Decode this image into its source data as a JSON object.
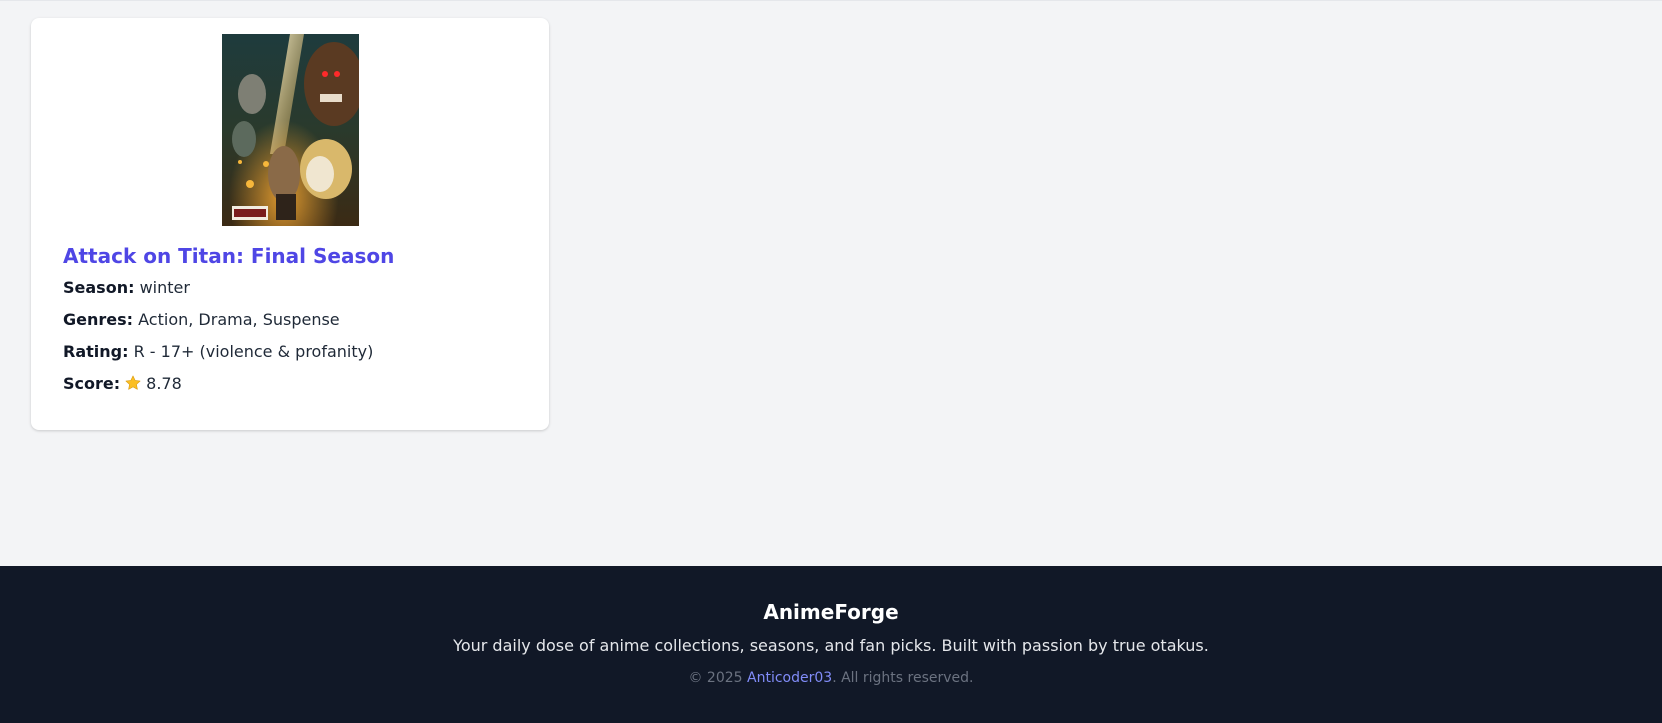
{
  "anime_card": {
    "poster_alt": "Attack on Titan: Final Season poster",
    "title": "Attack on Titan: Final Season",
    "season_label": "Season:",
    "season_value": "winter",
    "genres_label": "Genres:",
    "genres_value": "Action, Drama, Suspense",
    "rating_label": "Rating:",
    "rating_value": "R - 17+ (violence & profanity)",
    "score_label": "Score:",
    "score_icon": "star-icon",
    "score_value": "8.78"
  },
  "footer": {
    "brand": "AnimeForge",
    "tagline": "Your daily dose of anime collections, seasons, and fan picks. Built with passion by true otakus.",
    "copyright_prefix": "© 2025 ",
    "author_link": "Anticoder03",
    "copyright_suffix": ". All rights reserved."
  },
  "colors": {
    "page_background": "#f3f4f6",
    "title_accent": "#4f46e5",
    "footer_background": "#111827",
    "footer_link": "#818cf8",
    "star": "#fbbf24"
  }
}
